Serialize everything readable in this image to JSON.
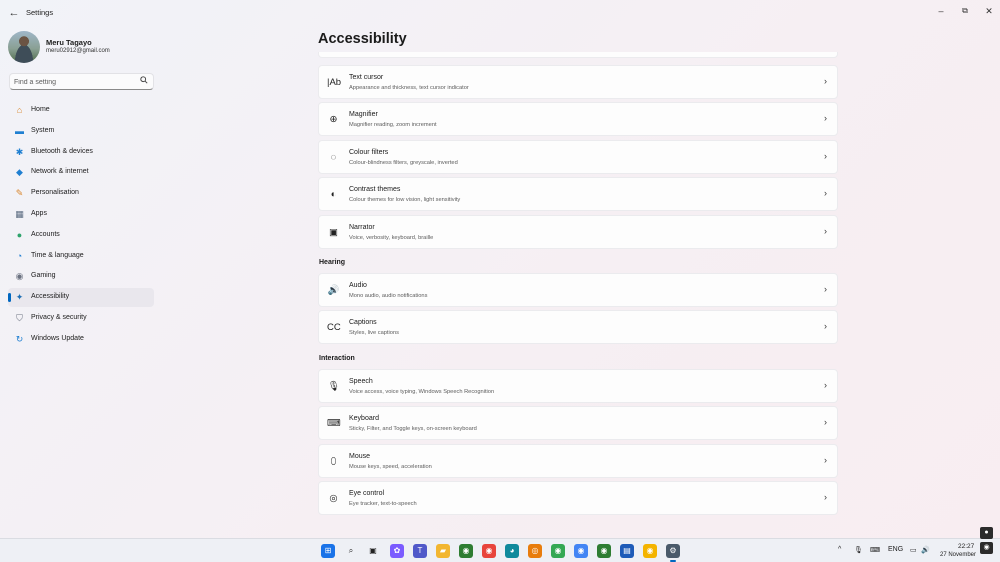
{
  "window": {
    "title": "Settings",
    "back_glyph": "←",
    "minimize_glyph": "–",
    "maximize_glyph": "⧉",
    "close_glyph": "✕"
  },
  "profile": {
    "name": "Meru Tagayo",
    "email": "meru02912@gmail.com"
  },
  "search": {
    "placeholder": "Find a setting",
    "icon": "search-icon"
  },
  "sidebar": {
    "selected": "Accessibility",
    "items": [
      {
        "label": "Home",
        "icon": "home-icon",
        "glyph": "⌂",
        "color": "#d9852b"
      },
      {
        "label": "System",
        "icon": "monitor-icon",
        "glyph": "▬",
        "color": "#1f7fd1"
      },
      {
        "label": "Bluetooth & devices",
        "icon": "bluetooth-icon",
        "glyph": "✱",
        "color": "#1f7fd1"
      },
      {
        "label": "Network & internet",
        "icon": "wifi-icon",
        "glyph": "◆",
        "color": "#1f7fd1"
      },
      {
        "label": "Personalisation",
        "icon": "brush-icon",
        "glyph": "✎",
        "color": "#d9852b"
      },
      {
        "label": "Apps",
        "icon": "apps-icon",
        "glyph": "▦",
        "color": "#5a6b80"
      },
      {
        "label": "Accounts",
        "icon": "person-icon",
        "glyph": "●",
        "color": "#2ea36b"
      },
      {
        "label": "Time & language",
        "icon": "globe-clock-icon",
        "glyph": "◔",
        "color": "#1f7fd1"
      },
      {
        "label": "Gaming",
        "icon": "gamepad-icon",
        "glyph": "◉",
        "color": "#6b7280"
      },
      {
        "label": "Accessibility",
        "icon": "accessibility-icon",
        "glyph": "✦",
        "color": "#1f6fb5"
      },
      {
        "label": "Privacy & security",
        "icon": "shield-icon",
        "glyph": "⛉",
        "color": "#6b7280"
      },
      {
        "label": "Windows Update",
        "icon": "update-icon",
        "glyph": "↻",
        "color": "#1f7fd1"
      }
    ]
  },
  "main": {
    "title": "Accessibility",
    "chevron": "›",
    "vision_rows": [
      {
        "title": "Text cursor",
        "subtitle": "Appearance and thickness, text cursor indicator",
        "icon": "text-cursor-icon",
        "glyph": "|Ab"
      },
      {
        "title": "Magnifier",
        "subtitle": "Magnifier reading, zoom increment",
        "icon": "magnifier-icon",
        "glyph": "⊕"
      },
      {
        "title": "Colour filters",
        "subtitle": "Colour-blindness filters, greyscale, inverted",
        "icon": "colour-filter-icon",
        "glyph": "◌"
      },
      {
        "title": "Contrast themes",
        "subtitle": "Colour themes for low vision, light sensitivity",
        "icon": "contrast-icon",
        "glyph": "◐"
      },
      {
        "title": "Narrator",
        "subtitle": "Voice, verbosity, keyboard, braille",
        "icon": "narrator-icon",
        "glyph": "▣"
      }
    ],
    "hearing": {
      "heading": "Hearing",
      "rows": [
        {
          "title": "Audio",
          "subtitle": "Mono audio, audio notifications",
          "icon": "speaker-icon",
          "glyph": "🔊"
        },
        {
          "title": "Captions",
          "subtitle": "Styles, live captions",
          "icon": "captions-icon",
          "glyph": "CC"
        }
      ]
    },
    "interaction": {
      "heading": "Interaction",
      "rows": [
        {
          "title": "Speech",
          "subtitle": "Voice access, voice typing, Windows Speech Recognition",
          "icon": "microphone-icon",
          "glyph": "🎙"
        },
        {
          "title": "Keyboard",
          "subtitle": "Sticky, Filter, and Toggle keys, on-screen keyboard",
          "icon": "keyboard-icon",
          "glyph": "⌨"
        },
        {
          "title": "Mouse",
          "subtitle": "Mouse keys, speed, acceleration",
          "icon": "mouse-icon",
          "glyph": "⬯"
        },
        {
          "title": "Eye control",
          "subtitle": "Eye tracker, text-to-speech",
          "icon": "eye-control-icon",
          "glyph": "◎"
        }
      ]
    }
  },
  "taskbar": {
    "apps": [
      {
        "name": "start-icon",
        "glyph": "⊞",
        "color": "#1a73e8"
      },
      {
        "name": "search-icon",
        "glyph": "⌕",
        "color": "#222222"
      },
      {
        "name": "task-view-icon",
        "glyph": "▣",
        "color": "#222222"
      },
      {
        "name": "copilot-icon",
        "glyph": "✿",
        "color": "#7b5cff"
      },
      {
        "name": "teams-icon",
        "glyph": "T",
        "color": "#5059c9"
      },
      {
        "name": "file-explorer-icon",
        "glyph": "▰",
        "color": "#f2b630"
      },
      {
        "name": "chrome-profile-icon",
        "glyph": "◉",
        "color": "#2e7d32"
      },
      {
        "name": "chrome-icon",
        "glyph": "◉",
        "color": "#e8453c"
      },
      {
        "name": "edge-icon",
        "glyph": "◕",
        "color": "#0f8a9c"
      },
      {
        "name": "blender-icon",
        "glyph": "◎",
        "color": "#e87d0d"
      },
      {
        "name": "chrome-profile-2-icon",
        "glyph": "◉",
        "color": "#34a853"
      },
      {
        "name": "chrome-profile-3-icon",
        "glyph": "◉",
        "color": "#4285f4"
      },
      {
        "name": "chrome-profile-4-icon",
        "glyph": "◉",
        "color": "#2e7d32"
      },
      {
        "name": "store-icon",
        "glyph": "▤",
        "color": "#1e5bb8"
      },
      {
        "name": "chrome-canary-icon",
        "glyph": "◉",
        "color": "#f4b400"
      },
      {
        "name": "settings-icon",
        "glyph": "⚙",
        "color": "#4a5a6a"
      }
    ],
    "tray": {
      "chevron": "^",
      "mic": "🎙",
      "keyboard": "⌨",
      "language": "ENG",
      "display": "▭",
      "volume": "🔊",
      "time": "22:27",
      "date": "27 November"
    }
  }
}
